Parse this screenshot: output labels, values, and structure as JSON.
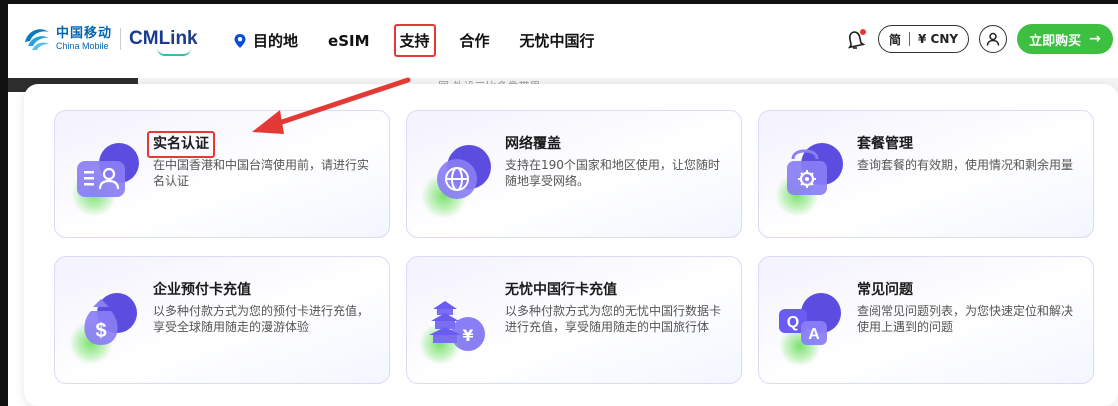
{
  "header": {
    "logo_cn": "中国移动",
    "logo_en": "China Mobile",
    "logo_brand": "CMLink",
    "nav": [
      {
        "label": "目的地",
        "icon": "location-pin-icon"
      },
      {
        "label": "eSIM"
      },
      {
        "label": "支持",
        "active": true
      },
      {
        "label": "合作"
      },
      {
        "label": "无忧中国行"
      }
    ],
    "lang_label": "简",
    "currency_label": "¥ CNY",
    "buy_label": "立即购买",
    "buy_arrow": "→"
  },
  "background_peek_text": "同  外设三比多像带里",
  "menu": {
    "cards": [
      {
        "title": "实名认证",
        "desc": "在中国香港和中国台湾使用前，请进行实名认证",
        "icon": "id-card-icon"
      },
      {
        "title": "网络覆盖",
        "desc": "支持在190个国家和地区使用，让您随时随地享受网络。",
        "icon": "globe-icon"
      },
      {
        "title": "套餐管理",
        "desc": "查询套餐的有效期，使用情况和剩余用量",
        "icon": "package-settings-icon"
      },
      {
        "title": "企业预付卡充值",
        "desc": "以多种付款方式为您的预付卡进行充值，享受全球随用随走的漫游体验",
        "icon": "money-bag-icon"
      },
      {
        "title": "无忧中国行卡充值",
        "desc": "以多种付款方式为您的无忧中国行数据卡进行充值，享受随用随走的中国旅行体",
        "icon": "pagoda-yuan-icon"
      },
      {
        "title": "常见问题",
        "desc": "查阅常见问题列表，为您快速定位和解决使用上遇到的问题",
        "icon": "qa-icon"
      }
    ]
  },
  "colors": {
    "accent_green": "#3dbf3f",
    "brand_blue": "#0066b3",
    "highlight_red": "#e53935",
    "card_border": "#d9dcf2",
    "icon_purple": "#6a5cf0"
  }
}
